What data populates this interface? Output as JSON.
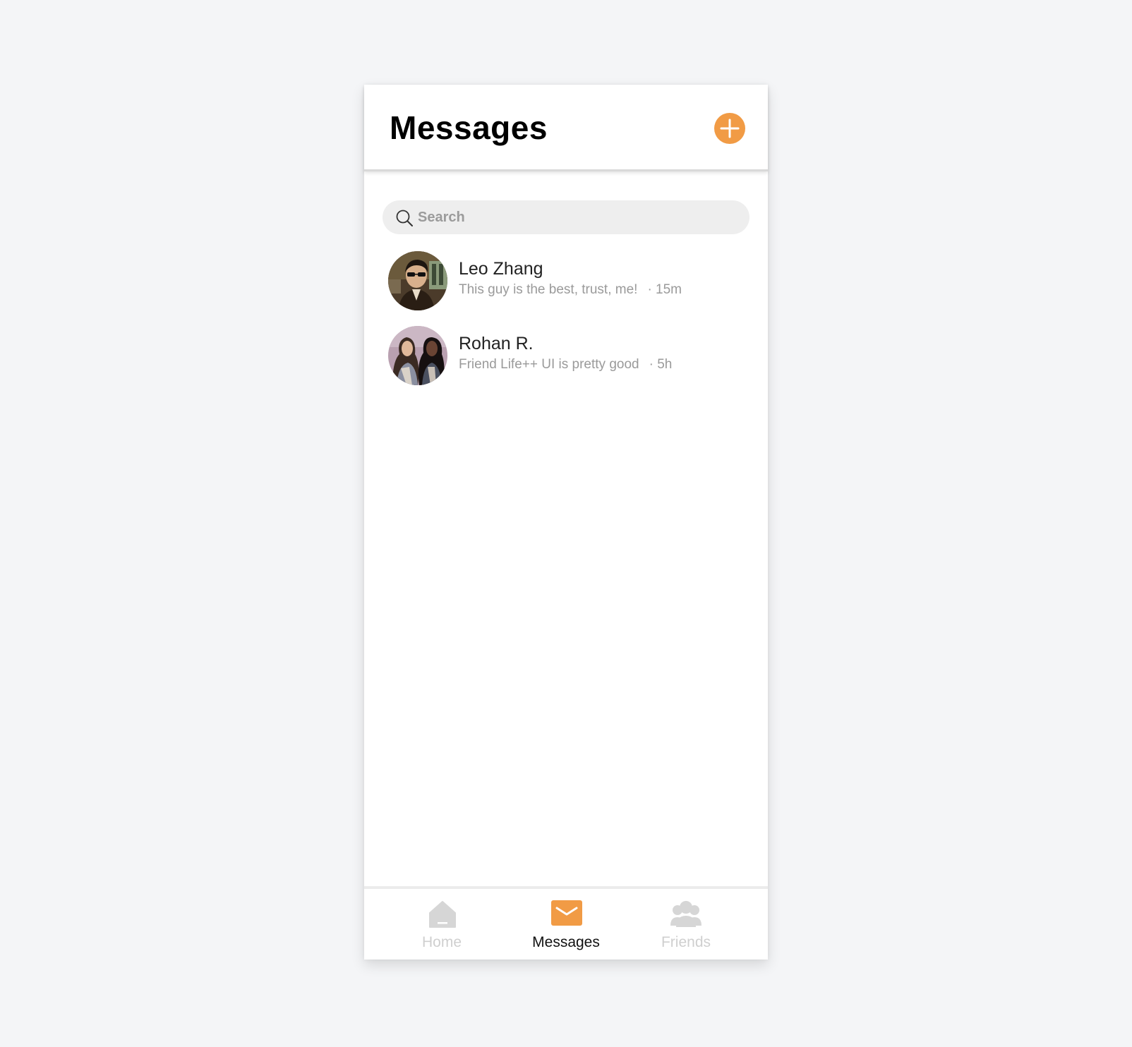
{
  "header": {
    "title": "Messages",
    "add_icon": "plus-circle-icon"
  },
  "search": {
    "placeholder": "Search",
    "value": "",
    "icon": "search-icon"
  },
  "conversations": [
    {
      "name": "Leo Zhang",
      "preview": "This guy is the best, trust, me!",
      "time": "· 15m",
      "avatar": "avatar-photo"
    },
    {
      "name": "Rohan R.",
      "preview": "Friend Life++ UI is pretty good",
      "time": "· 5h",
      "avatar": "avatar-photo"
    }
  ],
  "tabbar": {
    "tabs": [
      {
        "label": "Home",
        "icon": "home-icon",
        "active": false
      },
      {
        "label": "Messages",
        "icon": "mail-icon",
        "active": true
      },
      {
        "label": "Friends",
        "icon": "friends-icon",
        "active": false
      }
    ]
  },
  "colors": {
    "accent": "#f19b45",
    "background": "#f4f5f7",
    "inactive": "#d6d6d6"
  }
}
